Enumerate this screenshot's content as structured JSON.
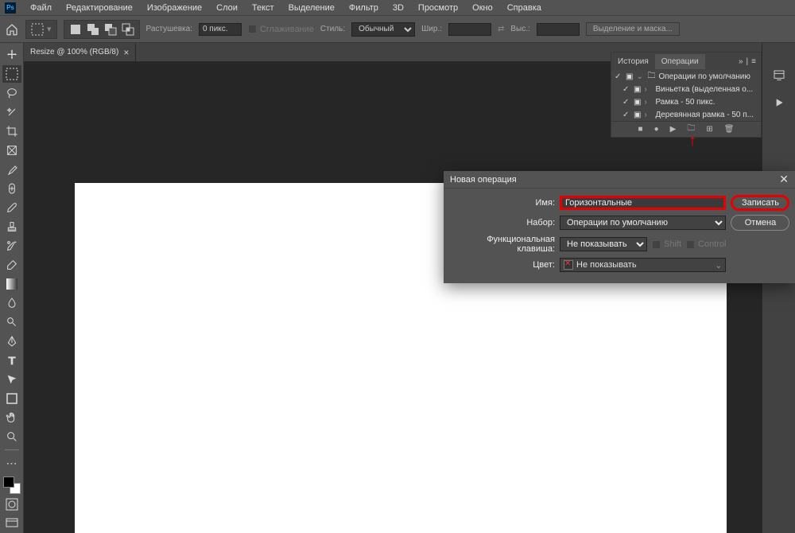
{
  "app": {
    "icon": "Ps"
  },
  "menu": [
    "Файл",
    "Редактирование",
    "Изображение",
    "Слои",
    "Текст",
    "Выделение",
    "Фильтр",
    "3D",
    "Просмотр",
    "Окно",
    "Справка"
  ],
  "options": {
    "feather_label": "Растушевка:",
    "feather_value": "0 пикс.",
    "antialias": "Сглаживание",
    "style_label": "Стиль:",
    "style_value": "Обычный",
    "width_label": "Шир.:",
    "height_label": "Выс.:",
    "select_mask": "Выделение и маска..."
  },
  "doc_tab": "Resize @ 100% (RGB/8)",
  "actions_panel": {
    "tab1": "История",
    "tab2": "Операции",
    "rows": [
      {
        "name": "Операции по умолчанию",
        "folder": true
      },
      {
        "name": "Виньетка (выделенная о...",
        "folder": false
      },
      {
        "name": "Рамка - 50 пикс.",
        "folder": false
      },
      {
        "name": "Деревянная рамка - 50 п...",
        "folder": false
      }
    ]
  },
  "dialog": {
    "title": "Новая операция",
    "name_label": "Имя:",
    "name_value": "Горизонтальные",
    "set_label": "Набор:",
    "set_value": "Операции по умолчанию",
    "fn_label": "Функциональная клавиша:",
    "fn_value": "Не показывать",
    "shift": "Shift",
    "control": "Control",
    "color_label": "Цвет:",
    "color_value": "Не показывать",
    "record": "Записать",
    "cancel": "Отмена"
  }
}
